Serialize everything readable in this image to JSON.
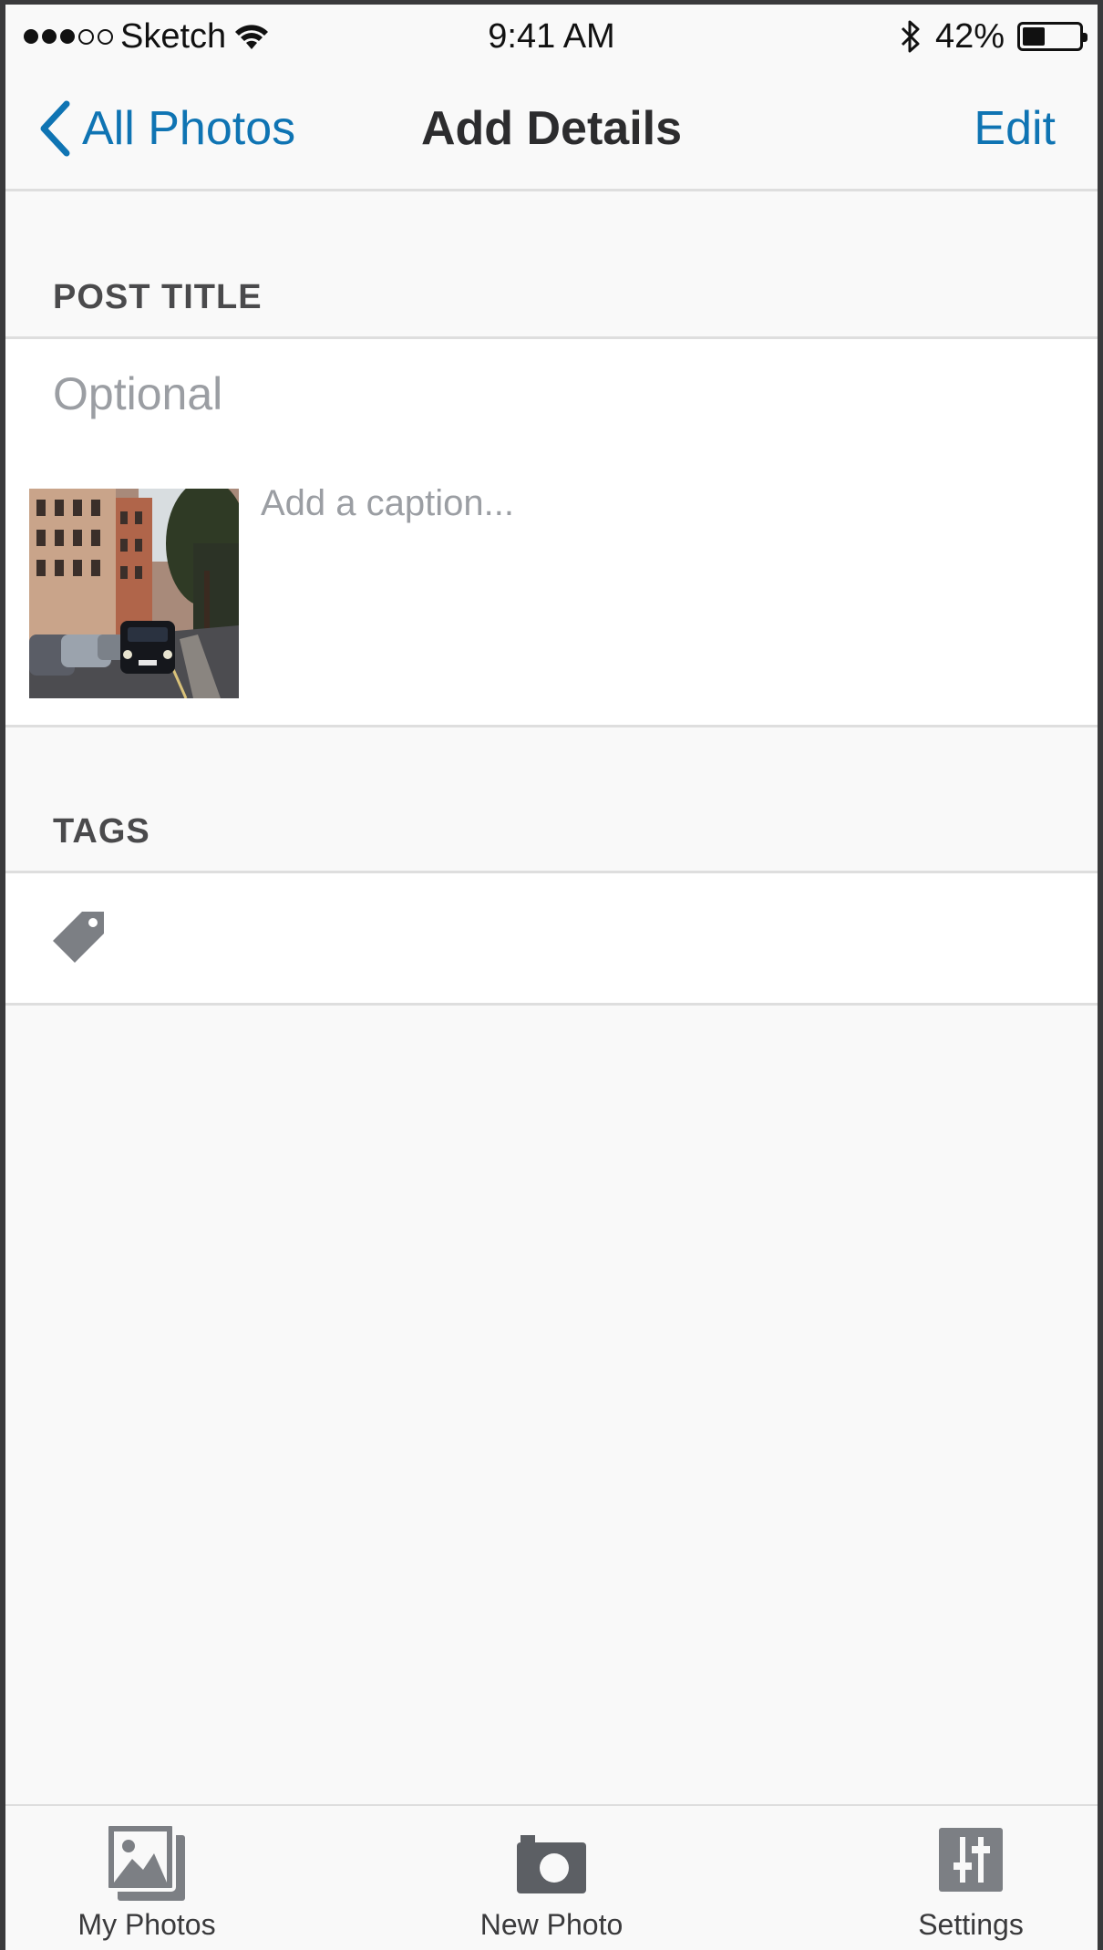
{
  "status_bar": {
    "carrier": "Sketch",
    "time": "9:41 AM",
    "battery": "42%",
    "battery_level": 0.42,
    "signal_bars_filled": 3,
    "signal_bars_total": 5
  },
  "nav": {
    "back_label": "All Photos",
    "title": "Add Details",
    "edit_label": "Edit"
  },
  "post_title": {
    "header": "POST TITLE",
    "placeholder": "Optional",
    "value": ""
  },
  "caption": {
    "placeholder": "Add a caption...",
    "value": ""
  },
  "tags": {
    "header": "TAGS",
    "icon": "tag-icon"
  },
  "tab_bar": {
    "items": [
      {
        "label": "My Photos",
        "icon": "photos-icon"
      },
      {
        "label": "New Photo",
        "icon": "camera-icon"
      },
      {
        "label": "Settings",
        "icon": "sliders-icon"
      }
    ]
  },
  "colors": {
    "accent": "#0f74b3",
    "background": "#f9f9f9",
    "separator": "#dedede",
    "placeholder": "#9b9ea3",
    "icon_gray": "#7c7f84"
  }
}
